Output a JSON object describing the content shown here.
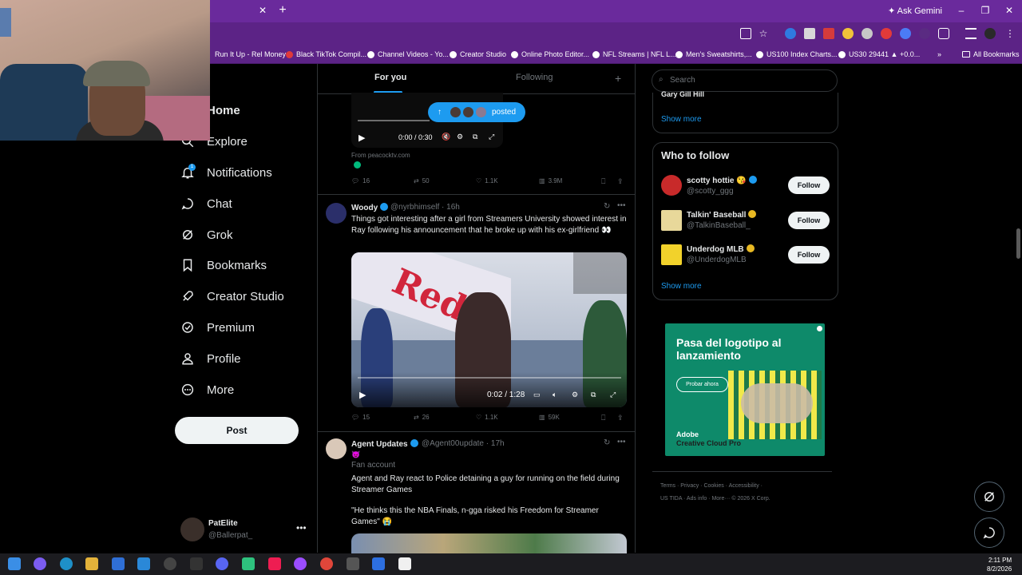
{
  "browser": {
    "ask_gemini": "Ask Gemini",
    "bookmarks": [
      "Run It Up - Rel Money",
      "Black TikTok Compil...",
      "Channel Videos - Yo...",
      "Creator Studio",
      "Online Photo Editor...",
      "NFL Streams | NFL L...",
      "Men's Sweatshirts,...",
      "US100 Index Charts...",
      "US30 29441 ▲ +0.0..."
    ],
    "all_bookmarks": "All Bookmarks"
  },
  "nav": {
    "items": [
      {
        "label": "Home",
        "icon": "home-icon"
      },
      {
        "label": "Explore",
        "icon": "search-icon"
      },
      {
        "label": "Notifications",
        "icon": "bell-icon"
      },
      {
        "label": "Chat",
        "icon": "chat-icon"
      },
      {
        "label": "Grok",
        "icon": "grok-icon"
      },
      {
        "label": "Bookmarks",
        "icon": "bookmark-icon"
      },
      {
        "label": "Creator Studio",
        "icon": "rocket-icon"
      },
      {
        "label": "Premium",
        "icon": "verified-icon"
      },
      {
        "label": "Profile",
        "icon": "person-icon"
      },
      {
        "label": "More",
        "icon": "more-circle-icon"
      }
    ],
    "notifications_badge": "1",
    "post_label": "Post",
    "account": {
      "name": "PatElite",
      "handle": "@Ballerpat_"
    }
  },
  "timeline": {
    "tabs": [
      "For you",
      "Following"
    ],
    "posted_pill": "posted",
    "tweet1": {
      "video_time": "0:00 / 0:30",
      "from": "From peacocktv.com",
      "replies": "16",
      "retweets": "50",
      "likes": "1.1K",
      "views": "3.9M"
    },
    "tweet2": {
      "name": "Woody",
      "handle": "@nyrbhimself",
      "time": "16h",
      "text": "Things got interesting after a girl from Streamers University showed interest in Ray following his announcement that he broke up with his ex-girlfriend 👀",
      "video_time": "0:02 / 1:28",
      "replies": "15",
      "retweets": "26",
      "likes": "1.1K",
      "views": "59K"
    },
    "tweet3": {
      "name": "Agent Updates",
      "handle": "@Agent00update",
      "time": "17h",
      "emoji": "😈",
      "label": "Fan account",
      "text1": "Agent and Ray react to Police detaining a guy for running on the field during Streamer Games",
      "text2": "\"He thinks this the NBA Finals, n-gga risked his Freedom for Streamer Games\" 😭"
    }
  },
  "right": {
    "search_placeholder": "Search",
    "trend_partial": "Gary Gill Hill",
    "show_more": "Show more",
    "who_to_follow": "Who to follow",
    "follow_label": "Follow",
    "suggestions": [
      {
        "name": "scotty hottie 😘",
        "handle": "@scotty_ggg"
      },
      {
        "name": "Talkin' Baseball",
        "handle": "@TalkinBaseball_"
      },
      {
        "name": "Underdog MLB",
        "handle": "@UnderdogMLB"
      }
    ],
    "ad": {
      "headline": "Pasa del logotipo al lanzamiento",
      "cta": "Probar ahora",
      "brand": "Adobe",
      "product": "Creative Cloud Pro"
    },
    "footer_line1": "Terms · Privacy · Cookies · Accessibility ·",
    "footer_line2": "US TIDA · Ads info · More··· © 2026 X Corp."
  },
  "taskbar": {
    "time": "2:11 PM",
    "date": "8/2/2026"
  },
  "colors": {
    "accent": "#1d9bf0",
    "chrome": "#6a2a9c",
    "background": "#000000"
  }
}
